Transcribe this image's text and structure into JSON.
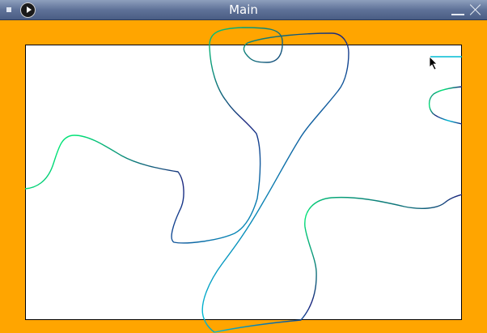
{
  "window": {
    "title": "Main",
    "background_color": "#ffa500",
    "titlebar_color": "#5f7298"
  },
  "canvas": {
    "background_color": "#ffffff",
    "curve_colors": [
      "#1a237e",
      "#00e676",
      "#00bcd4"
    ]
  },
  "icons": {
    "menu": "menu-square-icon",
    "app": "play-circle-icon",
    "minimize": "minimize-icon",
    "close": "close-x-icon",
    "cursor": "mouse-pointer-icon"
  }
}
